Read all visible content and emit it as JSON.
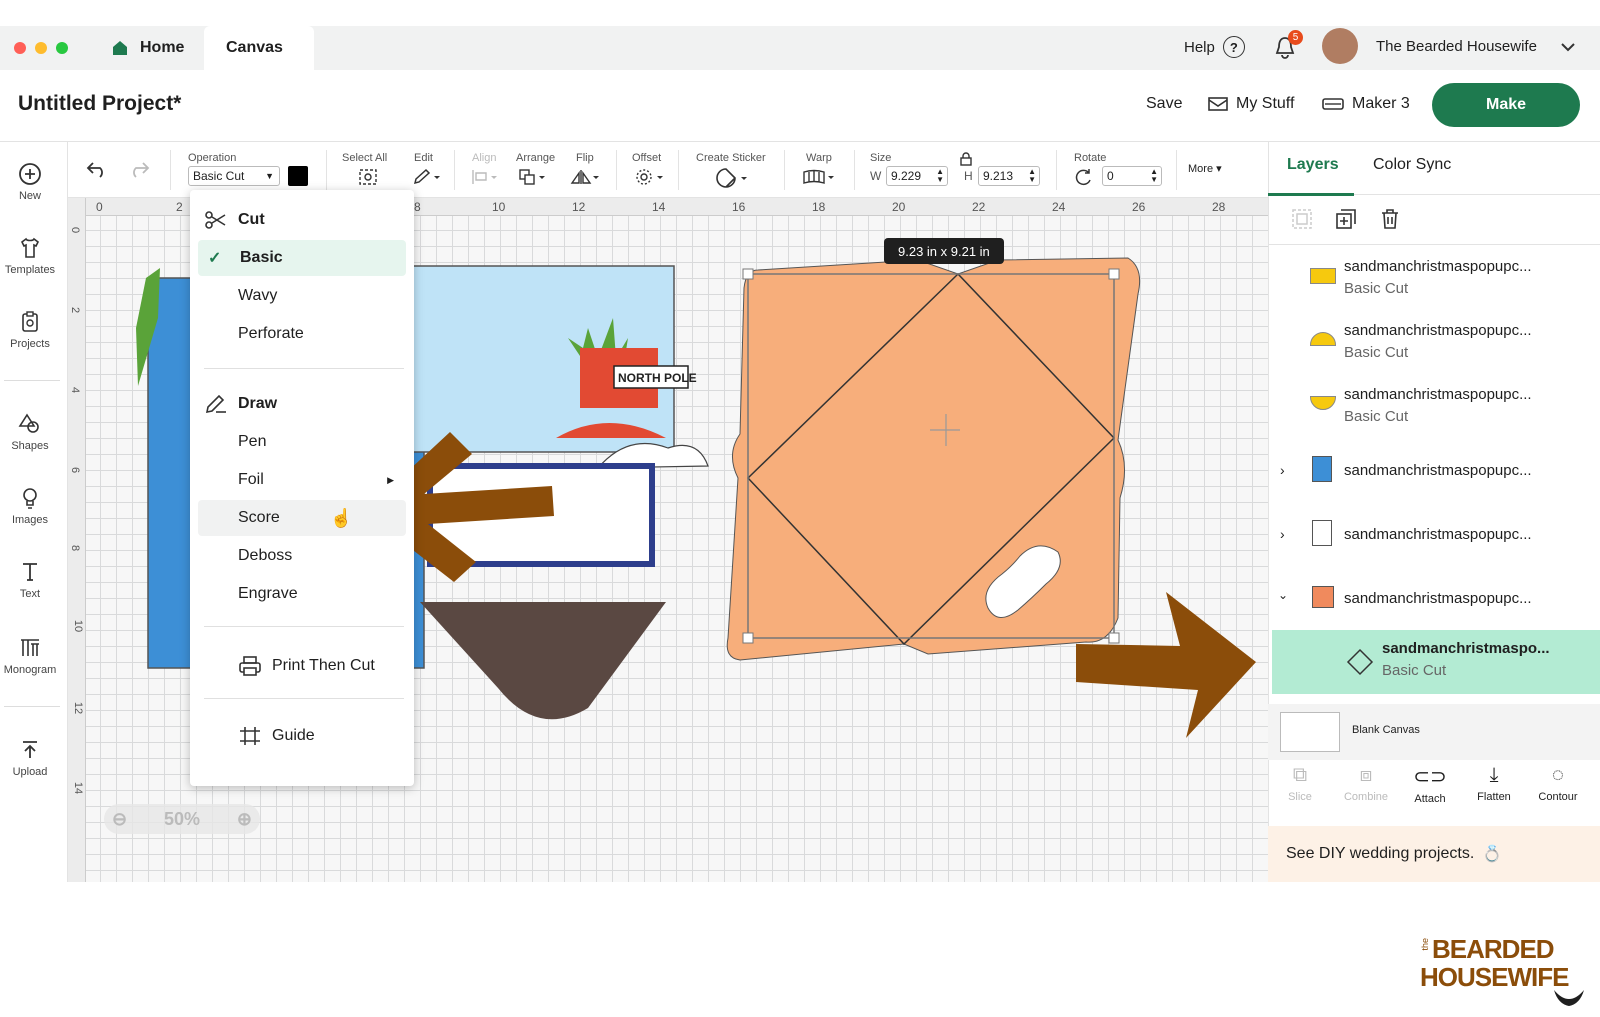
{
  "tabs": {
    "home": "Home",
    "canvas": "Canvas"
  },
  "topbar": {
    "help": "Help",
    "help_icon": "?",
    "notification_count": "5",
    "user_name": "The Bearded Housewife"
  },
  "header": {
    "project_title": "Untitled Project*",
    "save": "Save",
    "my_stuff": "My Stuff",
    "machine": "Maker 3",
    "make": "Make"
  },
  "sidebar": {
    "items": [
      {
        "label": "New",
        "icon": "plus-circle-icon"
      },
      {
        "label": "Templates",
        "icon": "shirt-icon"
      },
      {
        "label": "Projects",
        "icon": "clipboard-icon"
      },
      {
        "label": "Shapes",
        "icon": "shapes-icon"
      },
      {
        "label": "Images",
        "icon": "bulb-icon"
      },
      {
        "label": "Text",
        "icon": "text-icon"
      },
      {
        "label": "Monogram",
        "icon": "monogram-icon"
      },
      {
        "label": "Upload",
        "icon": "upload-icon"
      }
    ]
  },
  "toolbar": {
    "operation_label": "Operation",
    "operation_value": "Basic Cut",
    "select_all": "Select All",
    "edit": "Edit",
    "align": "Align",
    "arrange": "Arrange",
    "flip": "Flip",
    "offset": "Offset",
    "create_sticker": "Create Sticker",
    "warp": "Warp",
    "size": "Size",
    "w_label": "W",
    "w_value": "9.229",
    "h_label": "H",
    "h_value": "9.213",
    "rotate": "Rotate",
    "rotate_value": "0",
    "more": "More ▾"
  },
  "ruler": {
    "top": [
      "0",
      "2",
      "8",
      "10",
      "12",
      "14",
      "16",
      "18",
      "20",
      "22",
      "24",
      "26",
      "28"
    ],
    "left": [
      "0",
      "2",
      "4",
      "6",
      "8",
      "10",
      "12",
      "14"
    ]
  },
  "operation_menu": {
    "cut_header": "Cut",
    "cut_items": [
      "Basic",
      "Wavy",
      "Perforate"
    ],
    "draw_header": "Draw",
    "draw_items": [
      "Pen",
      "Foil",
      "Score",
      "Deboss",
      "Engrave"
    ],
    "print_then_cut": "Print Then Cut",
    "guide": "Guide",
    "selected": "Basic",
    "hovered": "Score"
  },
  "canvas": {
    "size_tooltip": "9.23  in x 9.21  in",
    "zoom": "50%",
    "sign_text": "NORTH POLE"
  },
  "panel": {
    "tabs": [
      "Layers",
      "Color Sync"
    ],
    "active_tab": "Layers",
    "layers": [
      {
        "name": "sandmanchristmaspopupc...",
        "sub": "Basic Cut",
        "color": "#f6c90e"
      },
      {
        "name": "sandmanchristmaspopupc...",
        "sub": "Basic Cut",
        "color": "#f6c90e"
      },
      {
        "name": "sandmanchristmaspopupc...",
        "sub": "Basic Cut",
        "color": "#f6c90e"
      },
      {
        "name": "sandmanchristmaspopupc...",
        "sub": "",
        "color": "#3d8fd6"
      },
      {
        "name": "sandmanchristmaspopupc...",
        "sub": "",
        "color": "#ffffff"
      },
      {
        "name": "sandmanchristmaspopupc...",
        "sub": "",
        "color": "#f08a5d"
      }
    ],
    "selected_layer": {
      "name": "sandmanchristmaspo...",
      "sub": "Basic Cut"
    },
    "blank_canvas": "Blank Canvas",
    "actions": [
      "Slice",
      "Combine",
      "Attach",
      "Flatten",
      "Contour"
    ],
    "promo": "See DIY wedding projects."
  },
  "watermark": {
    "line1": "BEARDED",
    "line2": "HOUSEWIFE",
    "prefix": "the"
  },
  "colors": {
    "accent": "#1e7a4f",
    "selection": "#b3ebd3",
    "envelope": "#f7ae7b",
    "arrow": "#8b4d0a"
  }
}
